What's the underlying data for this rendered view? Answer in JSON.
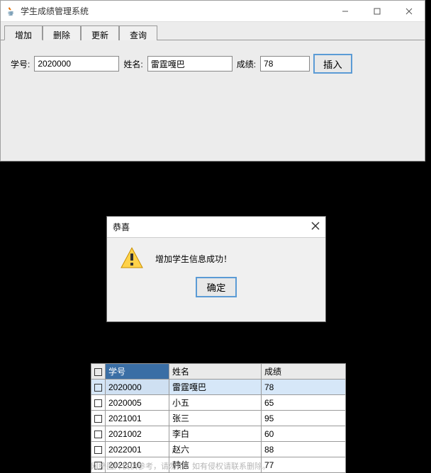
{
  "window": {
    "title": "学生成绩管理系统"
  },
  "tabs": {
    "add": "增加",
    "delete": "删除",
    "update": "更新",
    "query": "查询"
  },
  "form": {
    "id_label": "学号:",
    "id_value": "2020000",
    "name_label": "姓名:",
    "name_value": "雷霆嘎巴",
    "score_label": "成绩:",
    "score_value": "78",
    "insert_btn": "插入"
  },
  "dialog": {
    "title": "恭喜",
    "message": "增加学生信息成功！",
    "ok": "确定"
  },
  "table": {
    "headers": {
      "id": "学号",
      "name": "姓名",
      "score": "成绩"
    },
    "rows": [
      {
        "id": "2020000",
        "name": "雷霆嘎巴",
        "score": "78"
      },
      {
        "id": "2020005",
        "name": "小五",
        "score": "65"
      },
      {
        "id": "2021001",
        "name": "张三",
        "score": "95"
      },
      {
        "id": "2021002",
        "name": "李白",
        "score": "60"
      },
      {
        "id": "2022001",
        "name": "赵六",
        "score": "88"
      },
      {
        "id": "2022010",
        "name": "韩信",
        "score": "77"
      }
    ]
  },
  "footer_note": "网络图片仅供参考，请勿用，如有侵权请联系删除。"
}
